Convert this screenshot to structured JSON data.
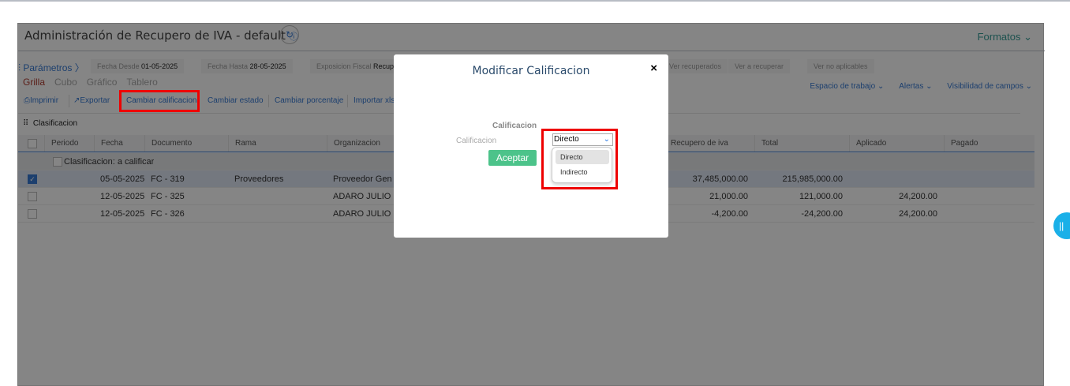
{
  "header": {
    "title": "Administración de Recupero de IVA - default",
    "formatos": "Formatos"
  },
  "params": {
    "label": "Parámetros",
    "fecha_desde_label": "Fecha Desde",
    "fecha_desde": "01-05-2025",
    "fecha_hasta_label": "Fecha Hasta",
    "fecha_hasta": "28-05-2025",
    "exposicion_label": "Exposicion Fiscal",
    "exposicion": "Recupe",
    "ver_recuperados": "Ver recuperados",
    "ver_a_recuperar": "Ver a recuperar",
    "ver_no_aplicables": "Ver no aplicables"
  },
  "views": [
    "Grilla",
    "Cubo",
    "Gráfico",
    "Tablero"
  ],
  "toolbar": {
    "imprimir": "Imprimir",
    "exportar": "Exportar",
    "cambiar_calificacion": "Cambiar calificacion",
    "cambiar_estado": "Cambiar estado",
    "cambiar_porcentaje": "Cambiar porcentaje",
    "importar": "Importar xls"
  },
  "right_links": {
    "espacio": "Espacio de trabajo",
    "alertas": "Alertas",
    "visibilidad": "Visibilidad de campos"
  },
  "grouping": "Clasificacion",
  "columns": [
    "Periodo",
    "Fecha",
    "Documento",
    "Rama",
    "Organizacion",
    "Recupero de iva",
    "Total",
    "Aplicado",
    "Pagado"
  ],
  "group_row": "Clasificacion: a calificar",
  "rows": [
    {
      "fecha": "05-05-2025",
      "documento": "FC - 319",
      "rama": "Proveedores",
      "organizacion": "Proveedor Gen",
      "recupero": "37,485,000.00",
      "total": "215,985,000.00",
      "aplicado": "",
      "pagado": ""
    },
    {
      "fecha": "12-05-2025",
      "documento": "FC - 325",
      "rama": "",
      "organizacion": "ADARO JULIO",
      "recupero": "21,000.00",
      "total": "121,000.00",
      "aplicado": "24,200.00",
      "pagado": ""
    },
    {
      "fecha": "12-05-2025",
      "documento": "FC - 326",
      "rama": "",
      "organizacion": "ADARO JULIO",
      "recupero": "-4,200.00",
      "total": "-24,200.00",
      "aplicado": "24,200.00",
      "pagado": ""
    }
  ],
  "modal": {
    "title": "Modificar Calificacion",
    "section": "Calificacion",
    "field_label": "Calificacion",
    "selected": "Directo",
    "options": [
      "Directo",
      "Indirecto"
    ],
    "accept": "Aceptar",
    "close": "×"
  }
}
